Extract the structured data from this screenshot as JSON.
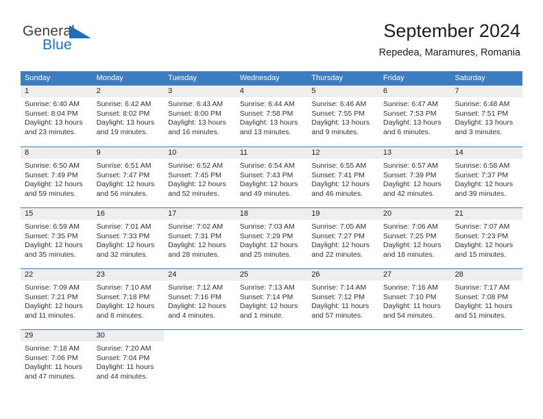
{
  "brand": {
    "name_part1": "General",
    "name_part2": "Blue",
    "flag_icon": "triangle-flag-icon"
  },
  "header": {
    "title": "September 2024",
    "subtitle": "Repedea, Maramures, Romania"
  },
  "colors": {
    "header_blue": "#3b7dc0",
    "daynum_band": "#eeeeee",
    "brand_blue": "#1c6fb8",
    "text": "#303030"
  },
  "weekdays": [
    "Sunday",
    "Monday",
    "Tuesday",
    "Wednesday",
    "Thursday",
    "Friday",
    "Saturday"
  ],
  "weeks": [
    [
      {
        "day": "1",
        "sunrise": "Sunrise: 6:40 AM",
        "sunset": "Sunset: 8:04 PM",
        "daylight1": "Daylight: 13 hours",
        "daylight2": "and 23 minutes."
      },
      {
        "day": "2",
        "sunrise": "Sunrise: 6:42 AM",
        "sunset": "Sunset: 8:02 PM",
        "daylight1": "Daylight: 13 hours",
        "daylight2": "and 19 minutes."
      },
      {
        "day": "3",
        "sunrise": "Sunrise: 6:43 AM",
        "sunset": "Sunset: 8:00 PM",
        "daylight1": "Daylight: 13 hours",
        "daylight2": "and 16 minutes."
      },
      {
        "day": "4",
        "sunrise": "Sunrise: 6:44 AM",
        "sunset": "Sunset: 7:58 PM",
        "daylight1": "Daylight: 13 hours",
        "daylight2": "and 13 minutes."
      },
      {
        "day": "5",
        "sunrise": "Sunrise: 6:46 AM",
        "sunset": "Sunset: 7:55 PM",
        "daylight1": "Daylight: 13 hours",
        "daylight2": "and 9 minutes."
      },
      {
        "day": "6",
        "sunrise": "Sunrise: 6:47 AM",
        "sunset": "Sunset: 7:53 PM",
        "daylight1": "Daylight: 13 hours",
        "daylight2": "and 6 minutes."
      },
      {
        "day": "7",
        "sunrise": "Sunrise: 6:48 AM",
        "sunset": "Sunset: 7:51 PM",
        "daylight1": "Daylight: 13 hours",
        "daylight2": "and 3 minutes."
      }
    ],
    [
      {
        "day": "8",
        "sunrise": "Sunrise: 6:50 AM",
        "sunset": "Sunset: 7:49 PM",
        "daylight1": "Daylight: 12 hours",
        "daylight2": "and 59 minutes."
      },
      {
        "day": "9",
        "sunrise": "Sunrise: 6:51 AM",
        "sunset": "Sunset: 7:47 PM",
        "daylight1": "Daylight: 12 hours",
        "daylight2": "and 56 minutes."
      },
      {
        "day": "10",
        "sunrise": "Sunrise: 6:52 AM",
        "sunset": "Sunset: 7:45 PM",
        "daylight1": "Daylight: 12 hours",
        "daylight2": "and 52 minutes."
      },
      {
        "day": "11",
        "sunrise": "Sunrise: 6:54 AM",
        "sunset": "Sunset: 7:43 PM",
        "daylight1": "Daylight: 12 hours",
        "daylight2": "and 49 minutes."
      },
      {
        "day": "12",
        "sunrise": "Sunrise: 6:55 AM",
        "sunset": "Sunset: 7:41 PM",
        "daylight1": "Daylight: 12 hours",
        "daylight2": "and 46 minutes."
      },
      {
        "day": "13",
        "sunrise": "Sunrise: 6:57 AM",
        "sunset": "Sunset: 7:39 PM",
        "daylight1": "Daylight: 12 hours",
        "daylight2": "and 42 minutes."
      },
      {
        "day": "14",
        "sunrise": "Sunrise: 6:58 AM",
        "sunset": "Sunset: 7:37 PM",
        "daylight1": "Daylight: 12 hours",
        "daylight2": "and 39 minutes."
      }
    ],
    [
      {
        "day": "15",
        "sunrise": "Sunrise: 6:59 AM",
        "sunset": "Sunset: 7:35 PM",
        "daylight1": "Daylight: 12 hours",
        "daylight2": "and 35 minutes."
      },
      {
        "day": "16",
        "sunrise": "Sunrise: 7:01 AM",
        "sunset": "Sunset: 7:33 PM",
        "daylight1": "Daylight: 12 hours",
        "daylight2": "and 32 minutes."
      },
      {
        "day": "17",
        "sunrise": "Sunrise: 7:02 AM",
        "sunset": "Sunset: 7:31 PM",
        "daylight1": "Daylight: 12 hours",
        "daylight2": "and 28 minutes."
      },
      {
        "day": "18",
        "sunrise": "Sunrise: 7:03 AM",
        "sunset": "Sunset: 7:29 PM",
        "daylight1": "Daylight: 12 hours",
        "daylight2": "and 25 minutes."
      },
      {
        "day": "19",
        "sunrise": "Sunrise: 7:05 AM",
        "sunset": "Sunset: 7:27 PM",
        "daylight1": "Daylight: 12 hours",
        "daylight2": "and 22 minutes."
      },
      {
        "day": "20",
        "sunrise": "Sunrise: 7:06 AM",
        "sunset": "Sunset: 7:25 PM",
        "daylight1": "Daylight: 12 hours",
        "daylight2": "and 18 minutes."
      },
      {
        "day": "21",
        "sunrise": "Sunrise: 7:07 AM",
        "sunset": "Sunset: 7:23 PM",
        "daylight1": "Daylight: 12 hours",
        "daylight2": "and 15 minutes."
      }
    ],
    [
      {
        "day": "22",
        "sunrise": "Sunrise: 7:09 AM",
        "sunset": "Sunset: 7:21 PM",
        "daylight1": "Daylight: 12 hours",
        "daylight2": "and 11 minutes."
      },
      {
        "day": "23",
        "sunrise": "Sunrise: 7:10 AM",
        "sunset": "Sunset: 7:18 PM",
        "daylight1": "Daylight: 12 hours",
        "daylight2": "and 8 minutes."
      },
      {
        "day": "24",
        "sunrise": "Sunrise: 7:12 AM",
        "sunset": "Sunset: 7:16 PM",
        "daylight1": "Daylight: 12 hours",
        "daylight2": "and 4 minutes."
      },
      {
        "day": "25",
        "sunrise": "Sunrise: 7:13 AM",
        "sunset": "Sunset: 7:14 PM",
        "daylight1": "Daylight: 12 hours",
        "daylight2": "and 1 minute."
      },
      {
        "day": "26",
        "sunrise": "Sunrise: 7:14 AM",
        "sunset": "Sunset: 7:12 PM",
        "daylight1": "Daylight: 11 hours",
        "daylight2": "and 57 minutes."
      },
      {
        "day": "27",
        "sunrise": "Sunrise: 7:16 AM",
        "sunset": "Sunset: 7:10 PM",
        "daylight1": "Daylight: 11 hours",
        "daylight2": "and 54 minutes."
      },
      {
        "day": "28",
        "sunrise": "Sunrise: 7:17 AM",
        "sunset": "Sunset: 7:08 PM",
        "daylight1": "Daylight: 11 hours",
        "daylight2": "and 51 minutes."
      }
    ],
    [
      {
        "day": "29",
        "sunrise": "Sunrise: 7:18 AM",
        "sunset": "Sunset: 7:06 PM",
        "daylight1": "Daylight: 11 hours",
        "daylight2": "and 47 minutes."
      },
      {
        "day": "30",
        "sunrise": "Sunrise: 7:20 AM",
        "sunset": "Sunset: 7:04 PM",
        "daylight1": "Daylight: 11 hours",
        "daylight2": "and 44 minutes."
      },
      {
        "day": "",
        "sunrise": "",
        "sunset": "",
        "daylight1": "",
        "daylight2": ""
      },
      {
        "day": "",
        "sunrise": "",
        "sunset": "",
        "daylight1": "",
        "daylight2": ""
      },
      {
        "day": "",
        "sunrise": "",
        "sunset": "",
        "daylight1": "",
        "daylight2": ""
      },
      {
        "day": "",
        "sunrise": "",
        "sunset": "",
        "daylight1": "",
        "daylight2": ""
      },
      {
        "day": "",
        "sunrise": "",
        "sunset": "",
        "daylight1": "",
        "daylight2": ""
      }
    ]
  ]
}
